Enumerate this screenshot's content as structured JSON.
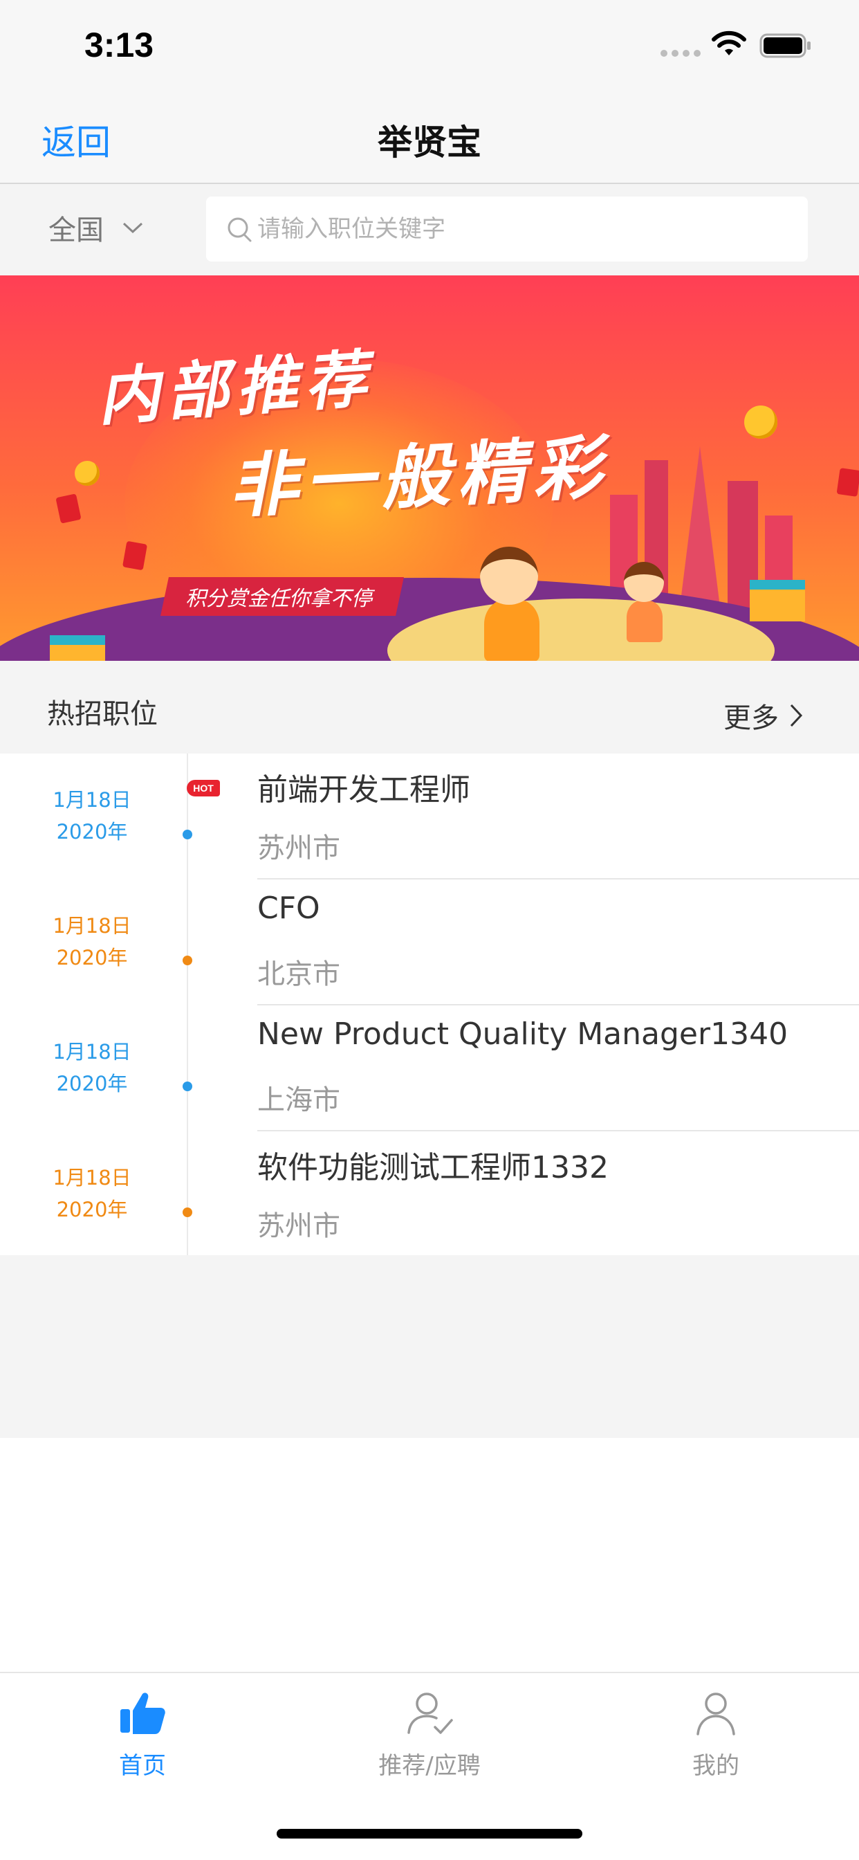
{
  "status_bar": {
    "time": "3:13"
  },
  "nav": {
    "back_label": "返回",
    "title": "举贤宝"
  },
  "search": {
    "region": "全国",
    "placeholder": "请输入职位关键字"
  },
  "banner": {
    "headline_line1": "内部推荐",
    "headline_line2": "非一般精彩",
    "tagline": "积分赏金任你拿不停"
  },
  "section": {
    "title": "热招职位",
    "more_label": "更多"
  },
  "jobs": [
    {
      "date_line1": "1月18日",
      "date_line2": "2020年",
      "title": "前端开发工程师",
      "city": "苏州市",
      "hot": true,
      "hot_label": "HOT",
      "accent": "#2a9be8"
    },
    {
      "date_line1": "1月18日",
      "date_line2": "2020年",
      "title": "CFO",
      "city": "北京市",
      "hot": false,
      "accent": "#f08a14"
    },
    {
      "date_line1": "1月18日",
      "date_line2": "2020年",
      "title": "New Product Quality Manager1340",
      "city": "上海市",
      "hot": false,
      "accent": "#2a9be8"
    },
    {
      "date_line1": "1月18日",
      "date_line2": "2020年",
      "title": "软件功能测试工程师1332",
      "city": "苏州市",
      "hot": false,
      "accent": "#f08a14"
    }
  ],
  "tabs": [
    {
      "label": "首页",
      "icon": "thumbs-up-icon",
      "active": true
    },
    {
      "label": "推荐/应聘",
      "icon": "user-check-icon",
      "active": false
    },
    {
      "label": "我的",
      "icon": "user-icon",
      "active": false
    }
  ],
  "colors": {
    "accent_blue": "#1a8cff",
    "date_blue": "#2a9be8",
    "date_orange": "#f08a14",
    "hot_red": "#e8232f"
  }
}
